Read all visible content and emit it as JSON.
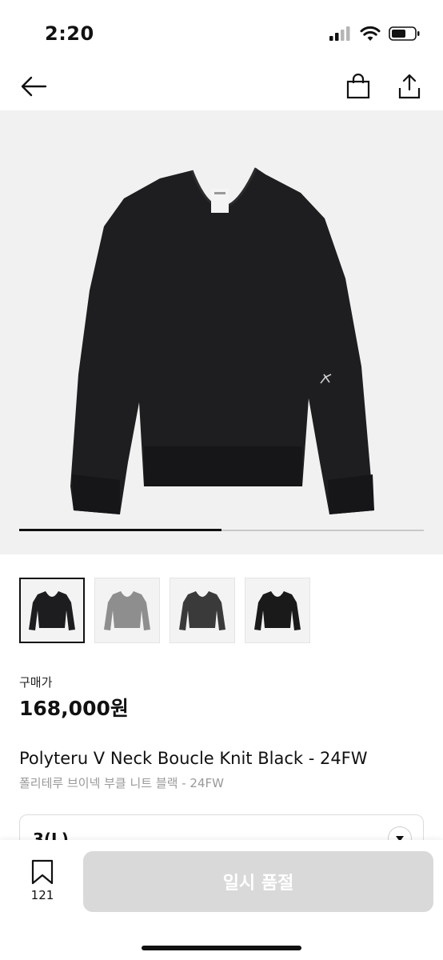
{
  "status_bar": {
    "time": "2:20"
  },
  "nav": {
    "back_icon": "arrow-left-icon",
    "cart_icon": "shopping-bag-icon",
    "share_icon": "share-icon"
  },
  "gallery": {
    "progress_fraction": 0.5
  },
  "thumbnails": [
    {
      "selected": true,
      "color": "#1d1d1f"
    },
    {
      "selected": false,
      "color": "#8e8e8e"
    },
    {
      "selected": false,
      "color": "#3a3a3a"
    },
    {
      "selected": false,
      "color": "#1a1a1a"
    }
  ],
  "product": {
    "price_label": "구매가",
    "price": "168,000원",
    "name_en": "Polyteru V Neck Boucle Knit Black - 24FW",
    "name_ko": "폴리테루 브이넥 부클 니트 블랙 - 24FW"
  },
  "option": {
    "selected_value": "3(L)"
  },
  "bottom_bar": {
    "bookmark_count": "121",
    "button_label": "일시 품절"
  },
  "colors": {
    "button_disabled": "#d9d9d9",
    "accent": "#111111"
  }
}
